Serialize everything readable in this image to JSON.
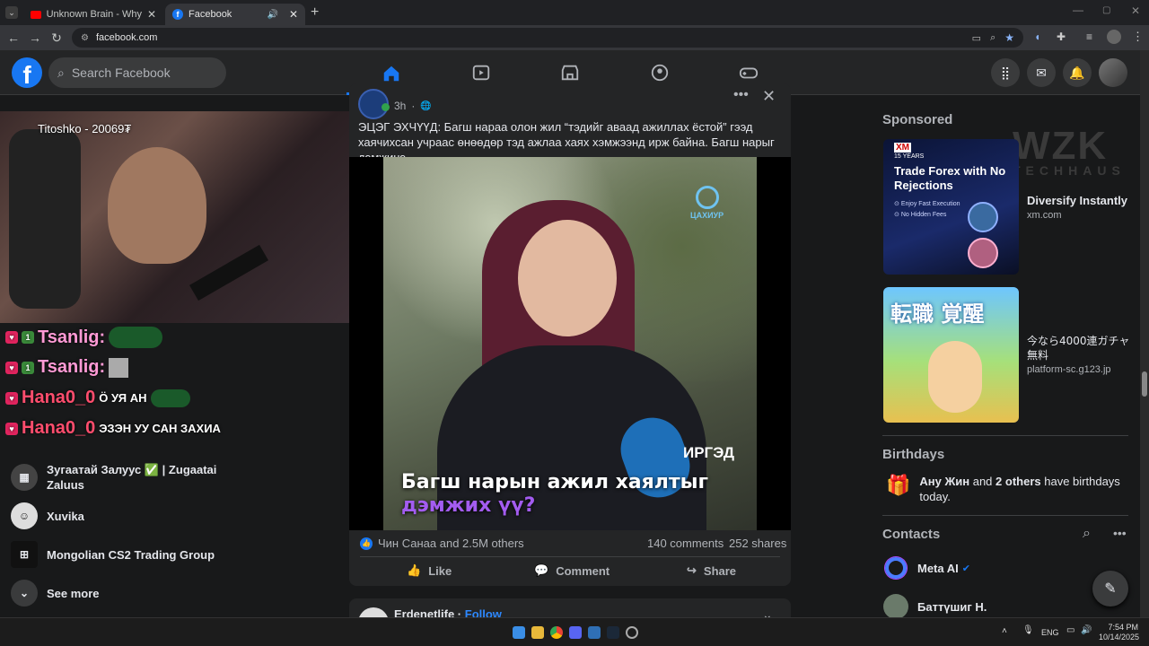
{
  "browser": {
    "tabs": [
      {
        "title": "Unknown Brain - Why Do I? (fe",
        "icon": "youtube-icon"
      },
      {
        "title": "Facebook",
        "icon": "facebook-icon"
      }
    ],
    "url": "facebook.com"
  },
  "header": {
    "logo": "f",
    "search_placeholder": "Search Facebook"
  },
  "stream": {
    "streamer_label": "Titoshko - 20069₮",
    "chat": [
      {
        "user": "Tsanlig:",
        "text": ""
      },
      {
        "user": "Tsanlig:",
        "text": ""
      },
      {
        "user": "Hana0_0",
        "text": "Ӧ УЯ АН"
      },
      {
        "user": "Hana0_0",
        "text": "ЭЗЭН УУ САН ЗАХИА"
      }
    ]
  },
  "shortcuts": [
    {
      "label": "Зугаатай Залуус ✅ | Zugaatai Zaluus",
      "badge": "✅"
    },
    {
      "label": "Xuvika"
    },
    {
      "label": "Mongolian CS2 Trading Group"
    },
    {
      "label": "See more"
    }
  ],
  "post": {
    "time": "3h",
    "text": "ЭЦЭГ ЭХЧҮҮД: Багш нараа олон жил “тэдийг аваад ажиллах ёстой” гээд хаячихсан учраас өнөөдөр тэд ажлаа хаях хэмжээнд ирж байна. Багш нарыг дэмжинэ",
    "video": {
      "brand": "ЦАХИУР",
      "tag": "ИРГЭД",
      "caption_line1": "Багш нарын ажил хаялтыг",
      "caption_line2": "дэмжих үү?"
    },
    "reactions": "Чин Санаа and 2.5M others",
    "comments": "140 comments",
    "shares": "252 shares",
    "actions": {
      "like": "Like",
      "comment": "Comment",
      "share": "Share"
    }
  },
  "next_post": {
    "author": "Erdenetlife",
    "follow": "Follow"
  },
  "sidebar": {
    "sponsored_title": "Sponsored",
    "ads": [
      {
        "headline": "Diversify Instantly",
        "domain": "xm.com",
        "img_brand": "XM",
        "img_years": "15 YEARS",
        "img_title": "Trade Forex with No Rejections",
        "img_bullet1": "Enjoy Fast Execution",
        "img_bullet2": "No Hidden Fees"
      },
      {
        "headline": "今なら4000連ガチャ無料",
        "domain": "platform-sc.g123.jp",
        "img_text": "転職 覚醒"
      }
    ],
    "birthdays_title": "Birthdays",
    "birthday_name": "Ану Жин",
    "birthday_others": "2 others",
    "birthday_and": "and",
    "birthday_rest": "have birthdays today.",
    "contacts_title": "Contacts",
    "contacts": [
      {
        "name": "Meta AI",
        "verified": true
      },
      {
        "name": "Баттүшиг Н."
      }
    ],
    "watermark": "WZK",
    "watermark_sub": "TECHHAUS"
  },
  "taskbar": {
    "lang": "ENG",
    "time": "7:54 PM",
    "date": "10/14/2025"
  },
  "colors": {
    "accent": "#1877f2",
    "bg": "#18191a",
    "card": "#242526"
  }
}
